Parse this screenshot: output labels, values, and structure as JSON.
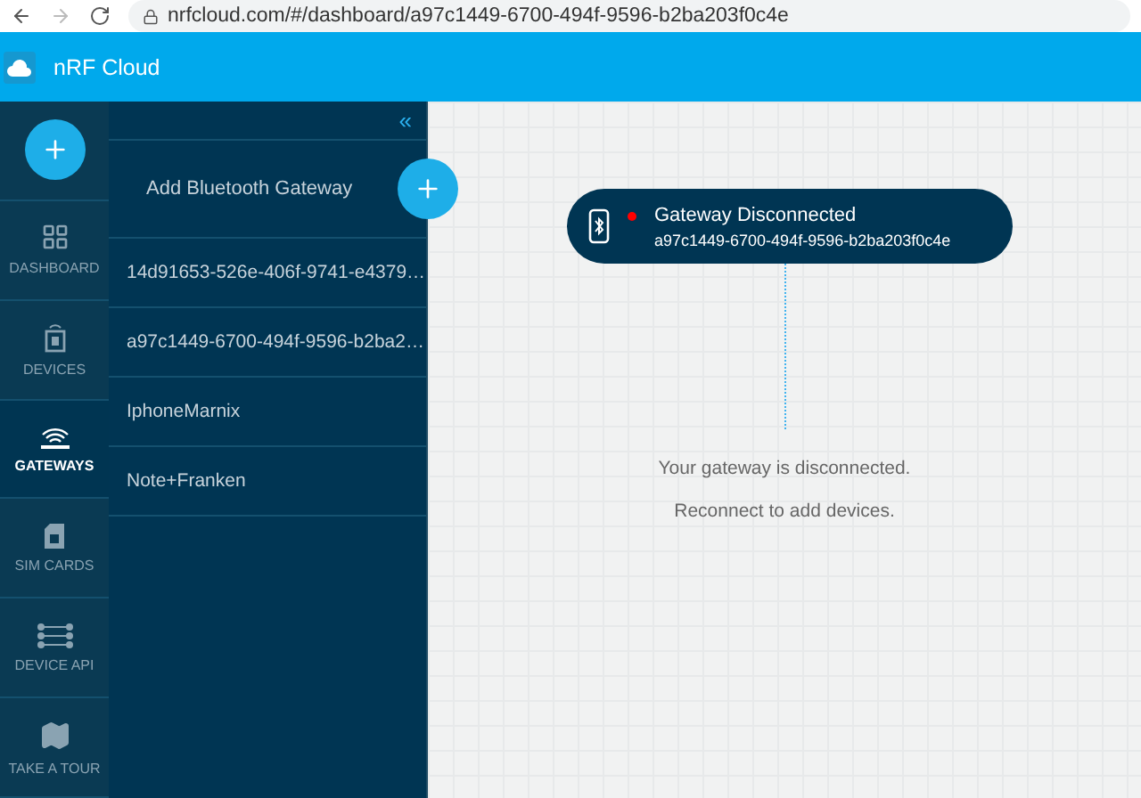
{
  "browser": {
    "url": "nrfcloud.com/#/dashboard/a97c1449-6700-494f-9596-b2ba203f0c4e"
  },
  "header": {
    "title": "nRF Cloud"
  },
  "nav": [
    {
      "kind": "dashboard",
      "label": "DASHBOARD",
      "selected": false
    },
    {
      "kind": "devices",
      "label": "DEVICES",
      "selected": false
    },
    {
      "kind": "gateways",
      "label": "GATEWAYS",
      "selected": true
    },
    {
      "kind": "sim",
      "label": "SIM CARDS",
      "selected": false
    },
    {
      "kind": "api",
      "label": "DEVICE API",
      "selected": false
    },
    {
      "kind": "tour",
      "label": "TAKE A TOUR",
      "selected": false
    }
  ],
  "panel": {
    "collapse": "«",
    "add_label": "Add Bluetooth Gateway",
    "gateways": [
      "14d91653-526e-406f-9741-e4379…",
      "a97c1449-6700-494f-9596-b2ba2…",
      "IphoneMarnix",
      "Note+Franken"
    ]
  },
  "gateway": {
    "status": "Gateway Disconnected",
    "connected": false,
    "id": "a97c1449-6700-494f-9596-b2ba203f0c4e",
    "messages": [
      "Your gateway is disconnected.",
      "Reconnect to add devices."
    ]
  }
}
